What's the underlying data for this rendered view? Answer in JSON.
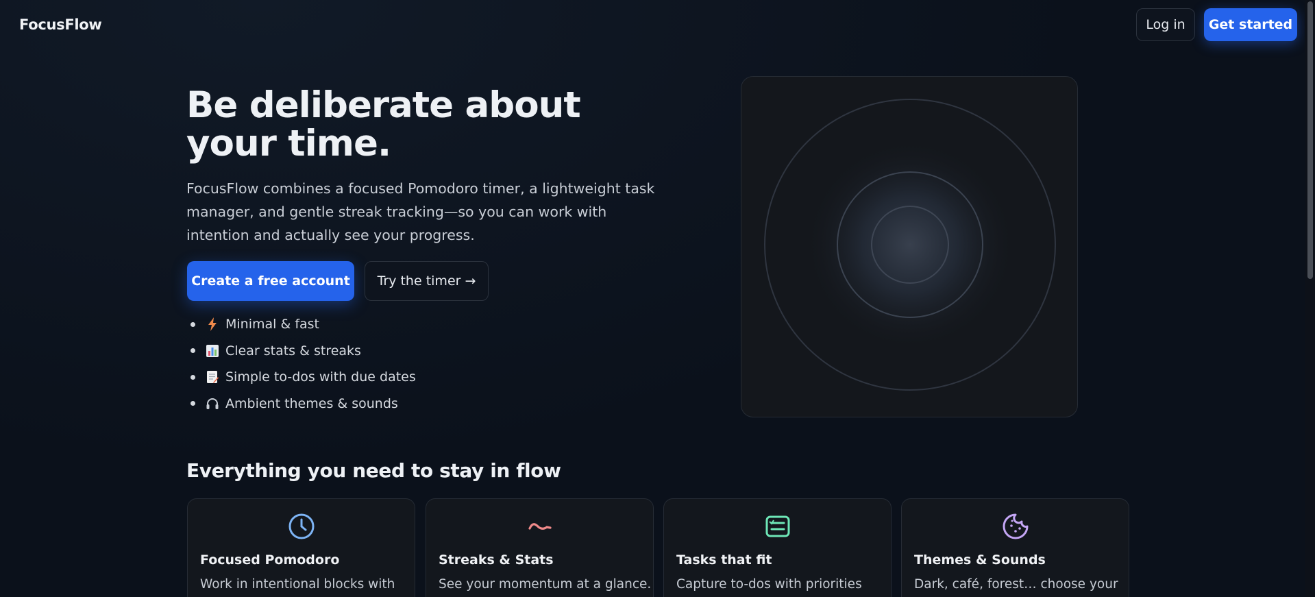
{
  "header": {
    "brand": "FocusFlow",
    "login_label": "Log in",
    "get_started_label": "Get started"
  },
  "hero": {
    "title": "Be deliberate about your time.",
    "subtitle": "FocusFlow combines a focused Pomodoro timer, a lightweight task manager, and gentle streak tracking—so you can work with intention and actually see your progress.",
    "primary_cta": "Create a free account",
    "secondary_cta": "Try the timer →",
    "features": [
      {
        "icon": "lightning-icon",
        "label": "Minimal & fast"
      },
      {
        "icon": "bar-chart-icon",
        "label": "Clear stats & streaks"
      },
      {
        "icon": "memo-icon",
        "label": "Simple to-dos with due dates"
      },
      {
        "icon": "headphones-icon",
        "label": "Ambient themes & sounds"
      }
    ]
  },
  "features_section": {
    "title": "Everything you need to stay in flow",
    "cards": [
      {
        "icon": "clock-icon",
        "title": "Focused Pomodoro",
        "desc": "Work in intentional blocks with"
      },
      {
        "icon": "activity-icon",
        "title": "Streaks & Stats",
        "desc": "See your momentum at a glance."
      },
      {
        "icon": "task-list-icon",
        "title": "Tasks that fit",
        "desc": "Capture to-dos with priorities"
      },
      {
        "icon": "cookie-icon",
        "title": "Themes & Sounds",
        "desc": "Dark, café, forest… choose your"
      }
    ]
  },
  "colors": {
    "background": "#0b111b",
    "accent": "#2563eb",
    "card": "#13171d",
    "clock_icon": "#7db4f5",
    "activity_icon": "#f08a8a",
    "task_icon": "#6ee7b7",
    "cookie_icon": "#c4a6f5"
  }
}
